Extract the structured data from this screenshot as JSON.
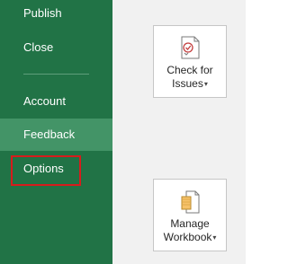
{
  "sidebar": {
    "items": [
      {
        "label": "Publish"
      },
      {
        "label": "Close"
      },
      {
        "label": "Account"
      },
      {
        "label": "Feedback"
      },
      {
        "label": "Options"
      }
    ]
  },
  "content": {
    "check_issues": {
      "line1": "Check for",
      "line2": "Issues",
      "caret": "▾",
      "icon": "check-document-icon"
    },
    "manage_workbook": {
      "line1": "Manage",
      "line2": "Workbook",
      "caret": "▾",
      "icon": "manage-workbook-icon"
    }
  },
  "colors": {
    "sidebar_bg": "#217346",
    "hover_bg": "#439467",
    "highlight_border": "#d71c1c",
    "content_bg": "#f1f1f1"
  }
}
